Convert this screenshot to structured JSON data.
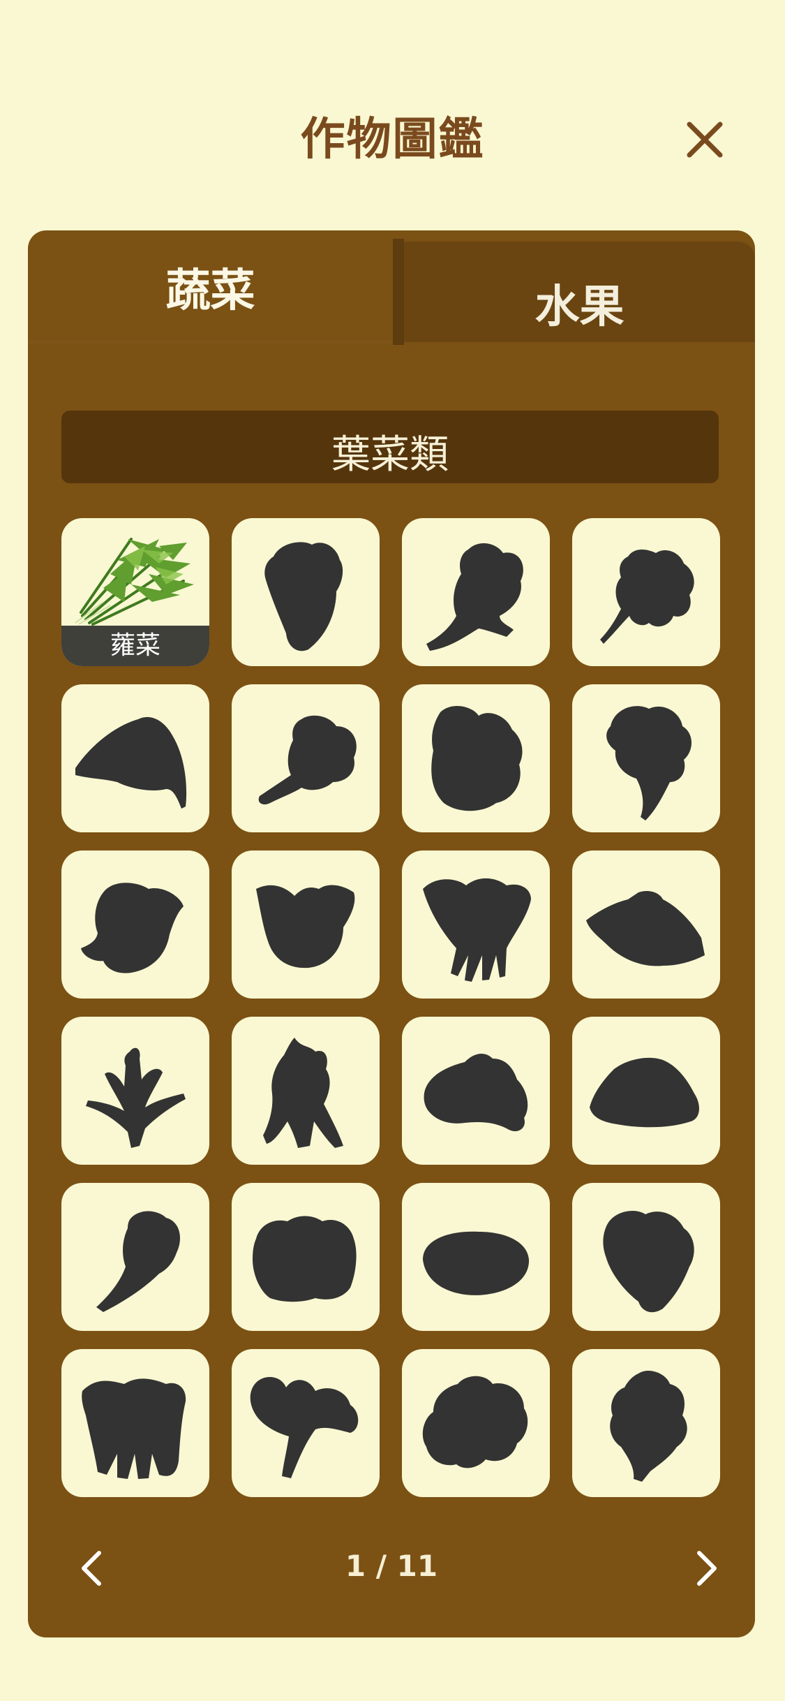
{
  "header": {
    "title": "作物圖鑑",
    "close_icon": "close-icon"
  },
  "tabs": [
    {
      "label": "蔬菜",
      "active": true
    },
    {
      "label": "水果",
      "active": false
    }
  ],
  "category": {
    "label": "葉菜類"
  },
  "grid": {
    "items": [
      {
        "name": "蕹菜",
        "unlocked": true,
        "icon": "water-spinach-photo"
      },
      {
        "unlocked": false,
        "icon": "locked-vegetable-silhouette"
      },
      {
        "unlocked": false,
        "icon": "locked-vegetable-silhouette"
      },
      {
        "unlocked": false,
        "icon": "locked-vegetable-silhouette"
      },
      {
        "unlocked": false,
        "icon": "locked-vegetable-silhouette"
      },
      {
        "unlocked": false,
        "icon": "locked-vegetable-silhouette"
      },
      {
        "unlocked": false,
        "icon": "locked-vegetable-silhouette"
      },
      {
        "unlocked": false,
        "icon": "locked-vegetable-silhouette"
      },
      {
        "unlocked": false,
        "icon": "locked-vegetable-silhouette"
      },
      {
        "unlocked": false,
        "icon": "locked-vegetable-silhouette"
      },
      {
        "unlocked": false,
        "icon": "locked-vegetable-silhouette"
      },
      {
        "unlocked": false,
        "icon": "locked-vegetable-silhouette"
      },
      {
        "unlocked": false,
        "icon": "locked-vegetable-silhouette"
      },
      {
        "unlocked": false,
        "icon": "locked-vegetable-silhouette"
      },
      {
        "unlocked": false,
        "icon": "locked-vegetable-silhouette"
      },
      {
        "unlocked": false,
        "icon": "locked-vegetable-silhouette"
      },
      {
        "unlocked": false,
        "icon": "locked-vegetable-silhouette"
      },
      {
        "unlocked": false,
        "icon": "locked-vegetable-silhouette"
      },
      {
        "unlocked": false,
        "icon": "locked-vegetable-silhouette"
      },
      {
        "unlocked": false,
        "icon": "locked-vegetable-silhouette"
      },
      {
        "unlocked": false,
        "icon": "locked-vegetable-silhouette"
      },
      {
        "unlocked": false,
        "icon": "locked-vegetable-silhouette"
      },
      {
        "unlocked": false,
        "icon": "locked-vegetable-silhouette"
      },
      {
        "unlocked": false,
        "icon": "locked-vegetable-silhouette"
      }
    ]
  },
  "pager": {
    "label": "1 / 11",
    "prev_icon": "chevron-left-icon",
    "next_icon": "chevron-right-icon"
  },
  "colors": {
    "background": "#f9f8d2",
    "title": "#7a4a1e",
    "panel": "#7b5114",
    "tab_inactive": "#6a4511",
    "category_bar": "#55350c",
    "silhouette": "#333333"
  }
}
